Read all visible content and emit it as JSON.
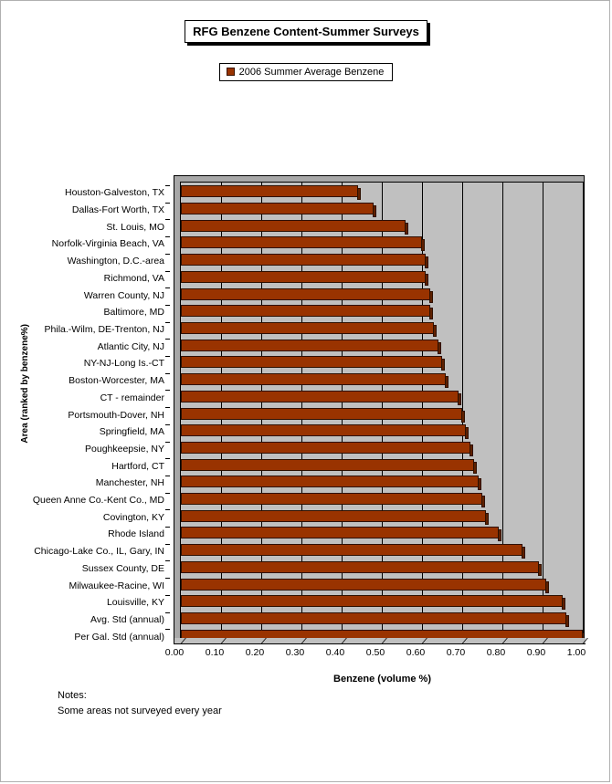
{
  "title": "RFG Benzene Content-Summer Surveys",
  "legend": {
    "entries": [
      {
        "label": "2006 Summer Average Benzene",
        "color": "#993300"
      }
    ]
  },
  "notes": {
    "heading": "Notes:",
    "line1": "Some areas not surveyed every year"
  },
  "colors": {
    "bar": "#993300",
    "bar_shadow": "#5e2000",
    "plot_background": "#c0c0c0",
    "plot_depth": "#a8a8a8",
    "axis": "#000000",
    "page_background": "#ffffff"
  },
  "chart_data": {
    "type": "bar",
    "orientation": "horizontal",
    "title": "RFG Benzene Content-Summer Surveys",
    "xlabel": "Benzene (volume %)",
    "ylabel": "Area (ranked by benzene%)",
    "xlim": [
      0.0,
      1.0
    ],
    "xticks": [
      "0.00",
      "0.10",
      "0.20",
      "0.30",
      "0.40",
      "0.50",
      "0.60",
      "0.70",
      "0.80",
      "0.90",
      "1.00"
    ],
    "xtick_values": [
      0.0,
      0.1,
      0.2,
      0.3,
      0.4,
      0.5,
      0.6,
      0.7,
      0.8,
      0.9,
      1.0
    ],
    "grid": true,
    "legend_position": "top",
    "series": [
      {
        "name": "2006 Summer Average Benzene",
        "color": "#993300",
        "values": [
          0.44,
          0.48,
          0.56,
          0.6,
          0.61,
          0.61,
          0.62,
          0.62,
          0.63,
          0.64,
          0.65,
          0.66,
          0.69,
          0.7,
          0.71,
          0.72,
          0.73,
          0.74,
          0.75,
          0.76,
          0.79,
          0.85,
          0.89,
          0.91,
          0.95,
          0.96,
          1.0
        ]
      }
    ],
    "categories": [
      "Houston-Galveston, TX",
      "Dallas-Fort Worth, TX",
      "St. Louis, MO",
      "Norfolk-Virginia Beach, VA",
      "Washington, D.C.-area",
      "Richmond, VA",
      "Warren County, NJ",
      "Baltimore, MD",
      "Phila.-Wilm, DE-Trenton, NJ",
      "Atlantic City, NJ",
      "NY-NJ-Long Is.-CT",
      "Boston-Worcester, MA",
      "CT - remainder",
      "Portsmouth-Dover, NH",
      "Springfield, MA",
      "Poughkeepsie, NY",
      "Hartford, CT",
      "Manchester, NH",
      "Queen Anne Co.-Kent Co., MD",
      "Covington, KY",
      "Rhode Island",
      "Chicago-Lake Co., IL, Gary, IN",
      "Sussex County, DE",
      "Milwaukee-Racine, WI",
      "Louisville, KY",
      "Avg. Std (annual)",
      "Per Gal. Std (annual)"
    ]
  }
}
